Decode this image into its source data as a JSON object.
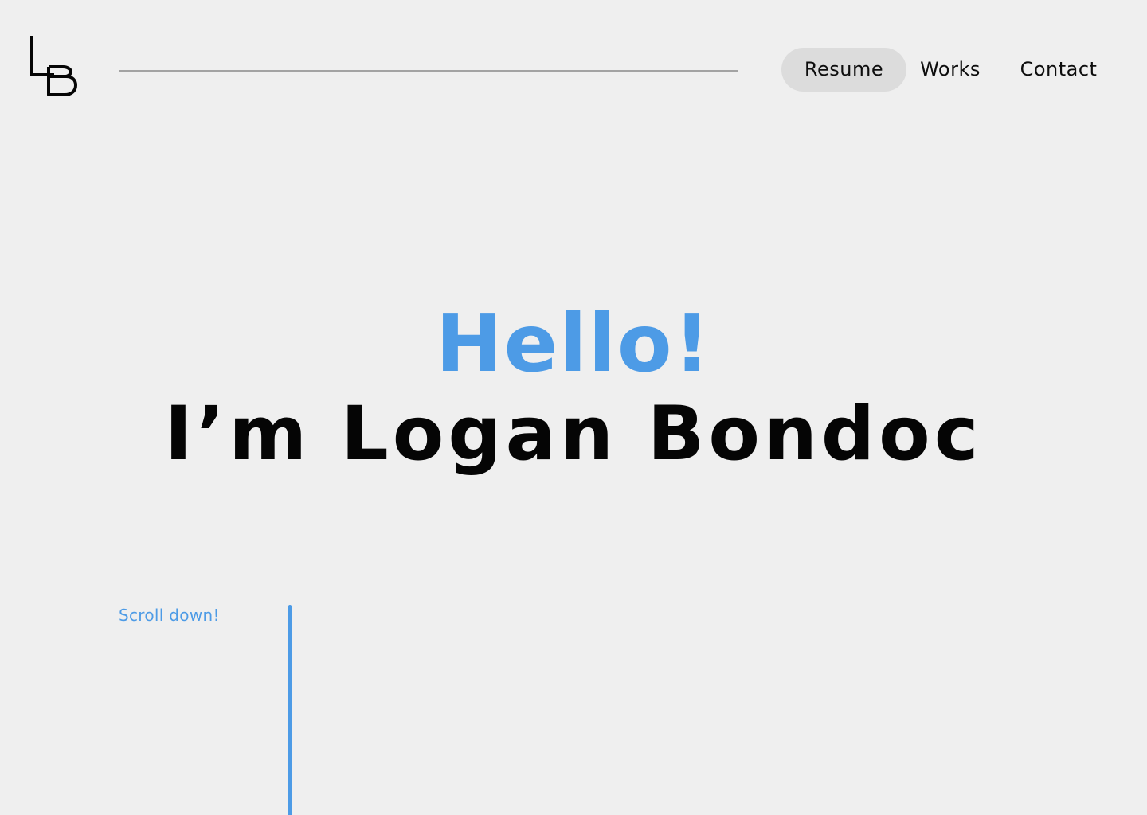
{
  "header": {
    "logo_text": "LB",
    "nav": {
      "resume": "Resume",
      "works": "Works",
      "contact": "Contact",
      "active": "Resume"
    }
  },
  "hero": {
    "greeting": "Hello!",
    "name": "I’m Logan Bondoc"
  },
  "scroll_cue": {
    "label": "Scroll down!"
  },
  "colors": {
    "background": "#efefef",
    "accent": "#4d9be6",
    "text": "#050505",
    "nav_active_bg": "#dcdcdc",
    "rule": "#a3a3a3"
  }
}
